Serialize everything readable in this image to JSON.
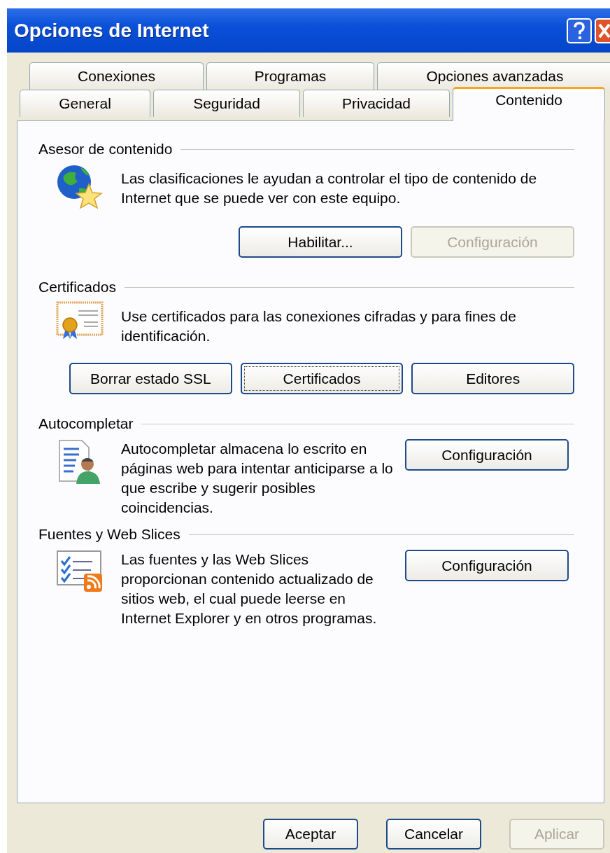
{
  "window": {
    "title": "Opciones de Internet"
  },
  "tab_rows": [
    {
      "tabs": [
        {
          "label": "Conexiones",
          "selected": false
        },
        {
          "label": "Programas",
          "selected": false
        },
        {
          "label": "Opciones avanzadas",
          "selected": false
        }
      ]
    },
    {
      "tabs": [
        {
          "label": "General",
          "selected": false
        },
        {
          "label": "Seguridad",
          "selected": false
        },
        {
          "label": "Privacidad",
          "selected": false
        },
        {
          "label": "Contenido",
          "selected": true
        }
      ]
    }
  ],
  "sections": [
    {
      "title": "Asesor de contenido",
      "kind": "stacked",
      "text": "Las clasificaciones le ayudan a controlar el tipo de contenido de Internet que se puede ver con este equipo.",
      "buttons": [
        {
          "label": "Habilitar...",
          "disabled": false,
          "focused": false
        },
        {
          "label": "Configuración",
          "disabled": true,
          "focused": false
        }
      ]
    },
    {
      "title": "Certificados",
      "kind": "stacked",
      "text": "Use certificados para las conexiones cifradas y para fines de identificación.",
      "buttons": [
        {
          "label": "Borrar estado SSL",
          "disabled": false,
          "focused": false
        },
        {
          "label": "Certificados",
          "disabled": false,
          "focused": true
        },
        {
          "label": "Editores",
          "disabled": false,
          "focused": false
        }
      ]
    },
    {
      "title": "Autocompletar",
      "kind": "side",
      "text": "Autocompletar almacena lo escrito en páginas web para intentar anticiparse a lo que escribe y sugerir posibles coincidencias.",
      "buttons": [
        {
          "label": "Configuración",
          "disabled": false,
          "focused": false
        }
      ]
    },
    {
      "title": "Fuentes y Web Slices",
      "kind": "side",
      "text": "Las fuentes y las Web Slices proporcionan contenido actualizado de sitios web, el cual puede leerse en Internet Explorer y en otros programas.",
      "buttons": [
        {
          "label": "Configuración",
          "disabled": false,
          "focused": false
        }
      ]
    }
  ],
  "footer_buttons": [
    {
      "label": "Aceptar",
      "disabled": false
    },
    {
      "label": "Cancelar",
      "disabled": false
    },
    {
      "label": "Aplicar",
      "disabled": true
    }
  ]
}
